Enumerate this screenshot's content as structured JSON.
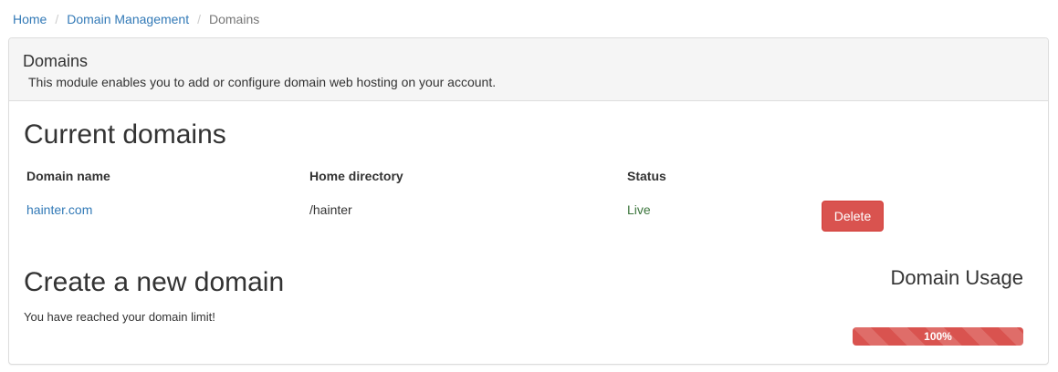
{
  "breadcrumb": {
    "items": [
      "Home",
      "Domain Management"
    ],
    "active": "Domains",
    "separator": "/"
  },
  "panel": {
    "title": "Domains",
    "description": "This module enables you to add or configure domain web hosting on your account."
  },
  "current": {
    "heading": "Current domains",
    "columns": [
      "Domain name",
      "Home directory",
      "Status"
    ],
    "rows": [
      {
        "domain": "hainter.com",
        "home": "/hainter",
        "status": "Live",
        "action": "Delete"
      }
    ]
  },
  "create": {
    "heading": "Create a new domain",
    "message": "You have reached your domain limit!"
  },
  "usage": {
    "heading": "Domain Usage",
    "percent": 100,
    "label": "100%"
  },
  "colors": {
    "link": "#337ab7",
    "danger": "#d9534f",
    "success": "#3c763d"
  }
}
